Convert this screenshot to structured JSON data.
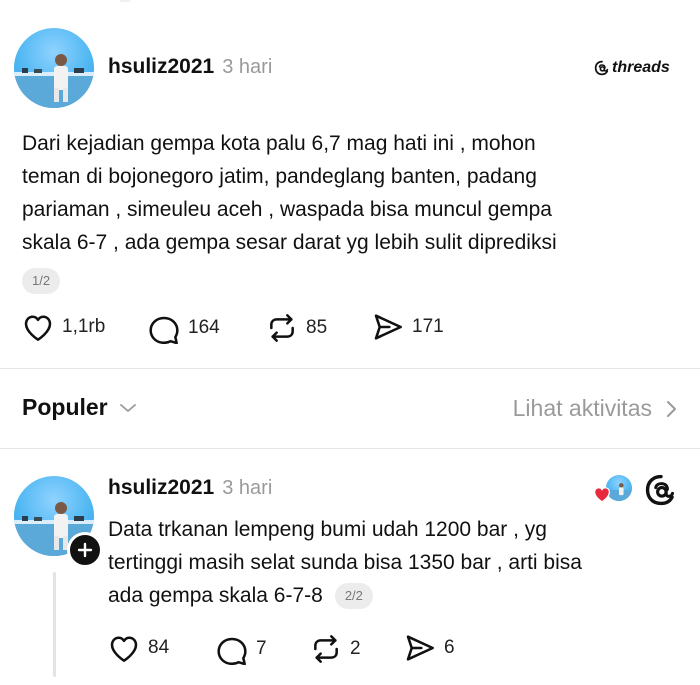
{
  "post1": {
    "username": "hsuliz2021",
    "time": "3 hari",
    "brand": "threads",
    "text_lines": [
      "Dari kejadian gempa kota palu 6,7 mag hati ini , mohon",
      "teman di bojonegoro  jatim, pandeglang banten, padang",
      "pariaman , simeuleu aceh , waspada bisa muncul gempa",
      "skala 6-7 , ada gempa sesar darat yg lebih sulit diprediksi"
    ],
    "page_badge": "1/2",
    "likes": "1,1rb",
    "replies": "164",
    "reposts": "85",
    "shares": "171"
  },
  "section": {
    "title": "Populer",
    "activity_link": "Lihat aktivitas"
  },
  "post2": {
    "username": "hsuliz2021",
    "time": "3 hari",
    "text_lines": [
      "Data trkanan lempeng bumi udah 1200 bar , yg",
      "tertinggi masih selat sunda bisa 1350 bar , arti bisa",
      "ada gempa skala 6-7-8"
    ],
    "page_badge": "2/2",
    "likes": "84",
    "replies": "7",
    "reposts": "2",
    "shares": "6"
  },
  "colors": {
    "accent_heart": "#e8283c",
    "muted": "#9a9a9a",
    "divider": "#e6e6e6"
  },
  "icons": [
    "heart-icon",
    "comment-icon",
    "repost-icon",
    "share-icon",
    "chevron-down-icon",
    "chevron-right-icon",
    "threads-logo-icon",
    "plus-icon"
  ]
}
